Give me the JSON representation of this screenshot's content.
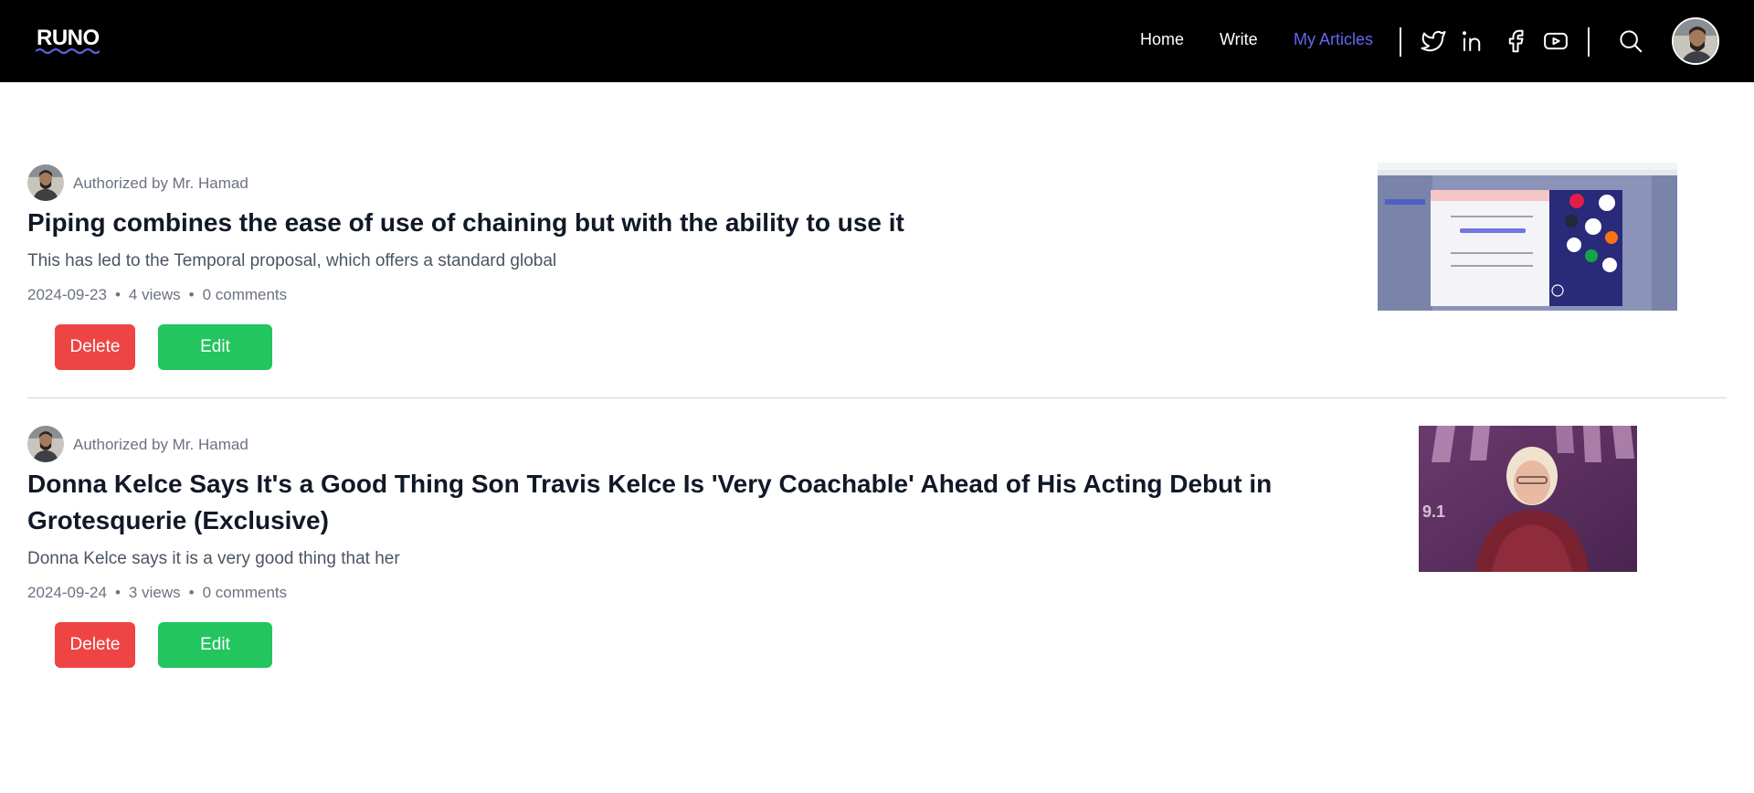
{
  "header": {
    "logo": "RUNO",
    "nav": [
      {
        "label": "Home"
      },
      {
        "label": "Write"
      },
      {
        "label": "My Articles"
      }
    ],
    "social_icons": [
      "twitter-icon",
      "linkedin-icon",
      "facebook-icon",
      "youtube-icon"
    ],
    "search_icon": "search-icon",
    "accent_color": "#6366f1"
  },
  "articles": [
    {
      "author": "Authorized by Mr. Hamad",
      "title": "Piping combines the ease of use of chaining but with the ability to use it",
      "excerpt": "This has led to the Temporal proposal, which offers a standard global",
      "date": "2024-09-23",
      "views": "4 views",
      "comments": "0 comments",
      "delete_label": "Delete",
      "edit_label": "Edit"
    },
    {
      "author": "Authorized by Mr. Hamad",
      "title_line1": "Donna Kelce Says It's a Good Thing Son Travis Kelce Is 'Very Coachable' Ahead of His Acting Debut in",
      "title_line2": "Grotesquerie (Exclusive)",
      "excerpt": "Donna Kelce says it is a very good thing that her",
      "date": "2024-09-24",
      "views": "3 views",
      "comments": "0 comments",
      "delete_label": "Delete",
      "edit_label": "Edit"
    }
  ],
  "colors": {
    "delete": "#ef4444",
    "edit": "#22c55e"
  }
}
